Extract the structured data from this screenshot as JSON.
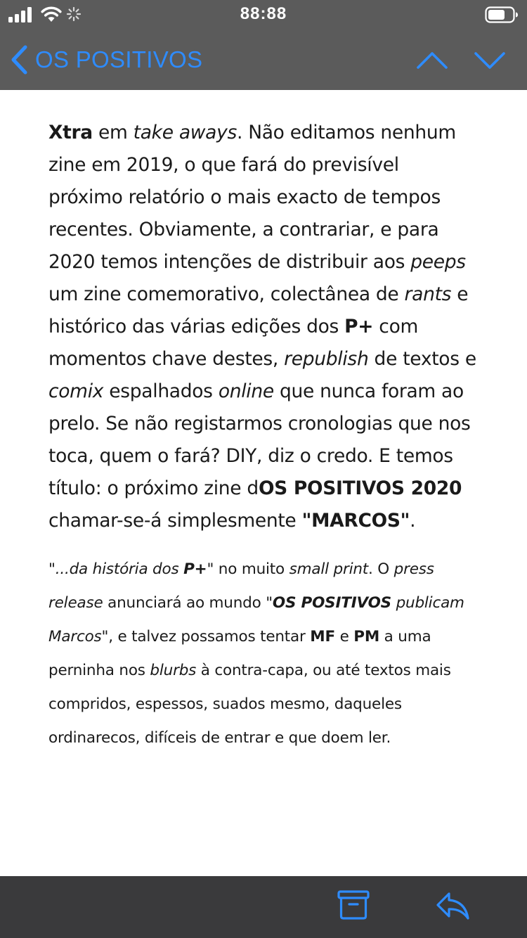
{
  "status_bar": {
    "time": "88:88",
    "icons": [
      "signal-icon",
      "wifi-icon",
      "activity-icon",
      "battery-icon"
    ]
  },
  "nav": {
    "back_label": "OS POSITIVOS",
    "back_icon": "chevron-left-icon",
    "prev_icon": "chevron-up-icon",
    "next_icon": "chevron-down-icon",
    "accent_color": "#2e8cff"
  },
  "body": {
    "p1": {
      "t1": "Xtra",
      "t2": " em ",
      "t3": "take aways",
      "t4": ". Não editamos nenhum zine em 2019, o que fará do previsível próximo relatório o mais exacto de tempos recentes. Obviamente, a contrariar, e para 2020 temos intenções de distribuir aos ",
      "t5": "peeps",
      "t6": " um zine comemorativo, colectânea de ",
      "t7": "rants",
      "t8": " e histórico das várias edições dos ",
      "t9": "P+",
      "t10": " com momentos chave destes, ",
      "t11": "republish",
      "t12": " de textos e ",
      "t13": "comix",
      "t14": " espalhados ",
      "t15": "online",
      "t16": " que nunca foram ao prelo. Se não registarmos cronologias que nos toca, quem o fará? DIY, diz o credo. E temos título: o próximo zine d",
      "t17": "OS POSITIVOS 2020",
      "t18": " chamar-se-á simplesmente ",
      "t19": "\"MARCOS\"",
      "t20": "."
    },
    "p2": {
      "t1": "\"...da história dos ",
      "t2": "P+",
      "t3": "\"",
      "t4": " no muito ",
      "t5": "small print",
      "t6": ". O ",
      "t7": "press release",
      "t8": " anunciará ao mundo ",
      "t9": "\"",
      "t10": "OS POSITIVOS",
      "t11": " publicam Marcos\"",
      "t12": ", e talvez possamos tentar ",
      "t13": "MF",
      "t14": " e ",
      "t15": "PM",
      "t16": " a uma perninha nos ",
      "t17": "blurbs",
      "t18": " à contra-capa, ou até textos mais compridos, espessos, suados mesmo, daqueles ordinarecos, difíceis de entrar e que doem ler."
    }
  },
  "toolbar": {
    "archive_icon": "archive-icon",
    "reply_icon": "reply-icon"
  }
}
